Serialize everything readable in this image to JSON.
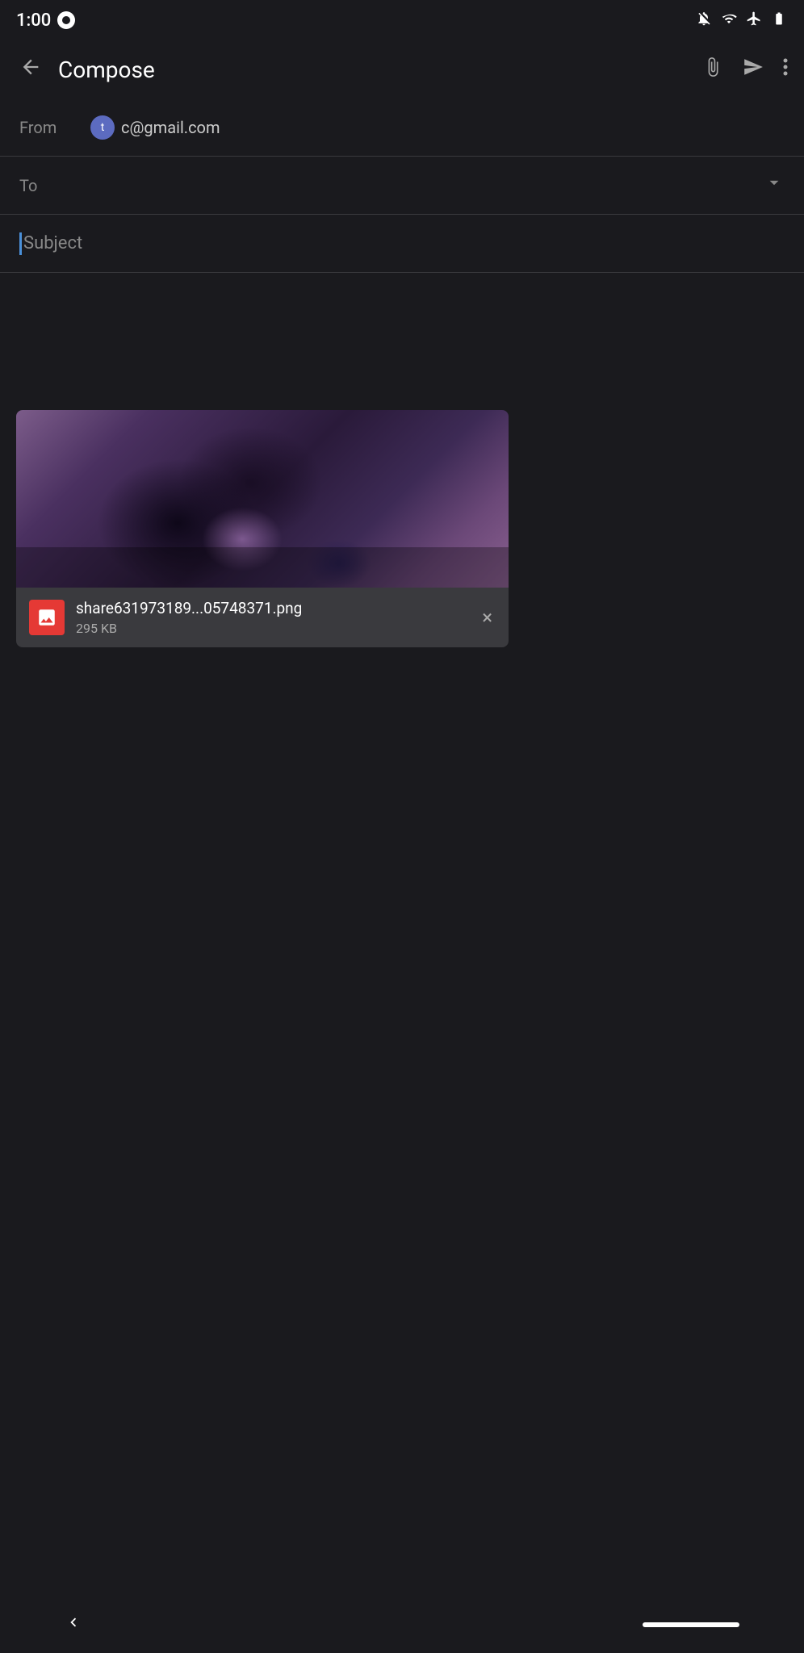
{
  "statusBar": {
    "time": "1:00",
    "icons": {
      "bell_muted": "🔕",
      "wifi": "wifi-icon",
      "airplane": "airplane-icon",
      "battery": "battery-icon"
    }
  },
  "appBar": {
    "title": "Compose",
    "back_label": "←",
    "attach_label": "attach-icon",
    "send_label": "send-icon",
    "more_label": "more-icon"
  },
  "form": {
    "from_label": "From",
    "from_avatar": "t",
    "from_email": "c@gmail.com",
    "to_label": "To",
    "to_placeholder": "",
    "subject_placeholder": "Subject"
  },
  "attachment": {
    "filename": "share631973189...05748371.png",
    "size": "295 KB",
    "remove_label": "×"
  },
  "bottomNav": {
    "back_label": "‹"
  }
}
